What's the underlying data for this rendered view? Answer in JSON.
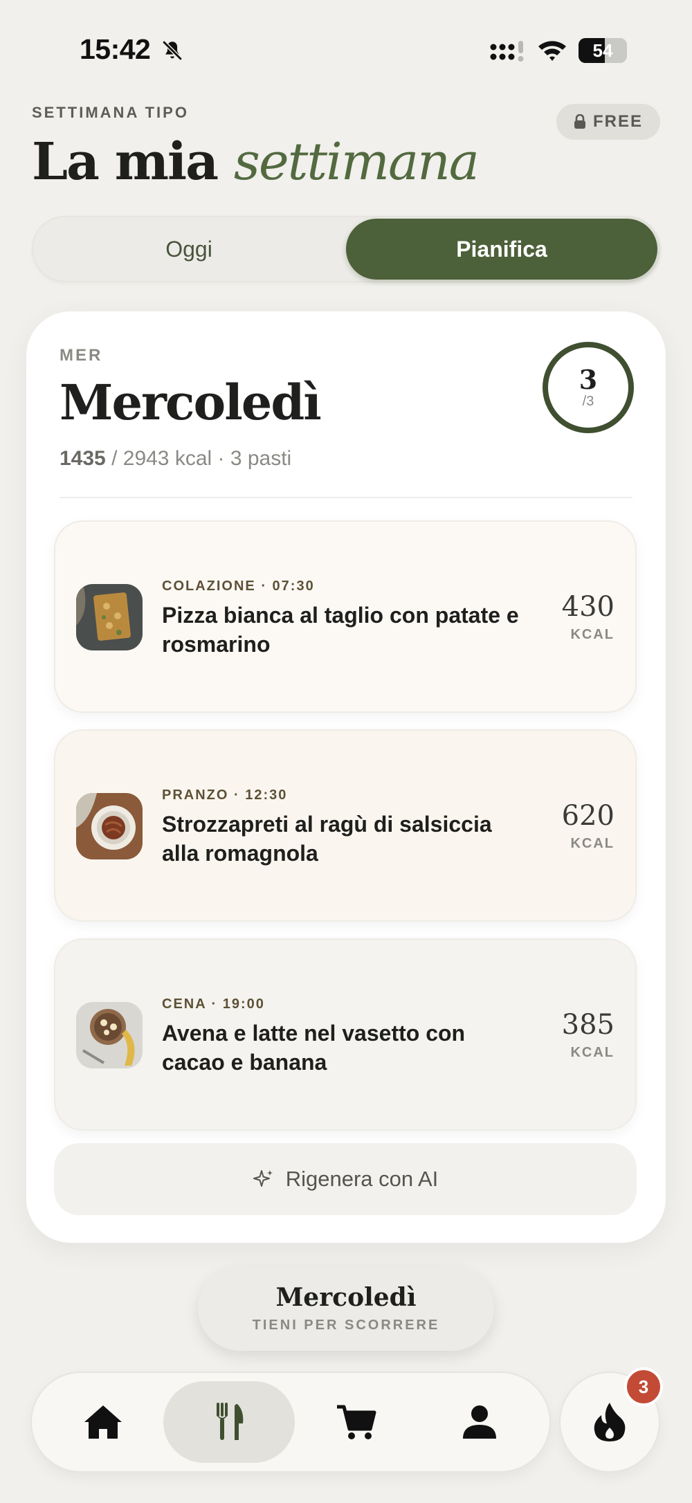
{
  "status_bar": {
    "time": "15:42",
    "battery": "54",
    "battery_level": 0.54
  },
  "header": {
    "eyebrow": "SETTIMANA TIPO",
    "title_main": "La mia",
    "title_accent": "settimana",
    "plan_badge": "FREE"
  },
  "segmented": {
    "today_label": "Oggi",
    "plan_label": "Pianifica",
    "selected": "Pianifica"
  },
  "day": {
    "abbr": "MER",
    "name": "Mercoledì",
    "kcal_consumed": "1435",
    "kcal_rest": " / 2943 kcal · 3 pasti",
    "meals_done": "3",
    "meals_total": "/3"
  },
  "meals": [
    {
      "label": "COLAZIONE · 07:30",
      "title": "Pizza bianca al taglio con patate e rosmarino",
      "kcal": "430",
      "unit": "KCAL"
    },
    {
      "label": "PRANZO · 12:30",
      "title": "Strozzapreti al ragù di salsiccia alla romagnola",
      "kcal": "620",
      "unit": "KCAL"
    },
    {
      "label": "CENA · 19:00",
      "title": "Avena e latte nel vasetto con cacao e banana",
      "kcal": "385",
      "unit": "KCAL"
    }
  ],
  "regen_label": "Rigenera con AI",
  "day_pill": {
    "name": "Mercoledì",
    "hint": "TIENI PER SCORRERE"
  },
  "tab_bar": {
    "items": [
      "home-icon",
      "fork-knife-icon",
      "cart-icon",
      "profile-icon"
    ],
    "active": "fork-knife-icon",
    "streak_icon": "flame-icon",
    "streak_badge": "3"
  },
  "colors": {
    "accent": "#4c6039",
    "badge": "#c34b36",
    "background": "#f1f0ec"
  }
}
